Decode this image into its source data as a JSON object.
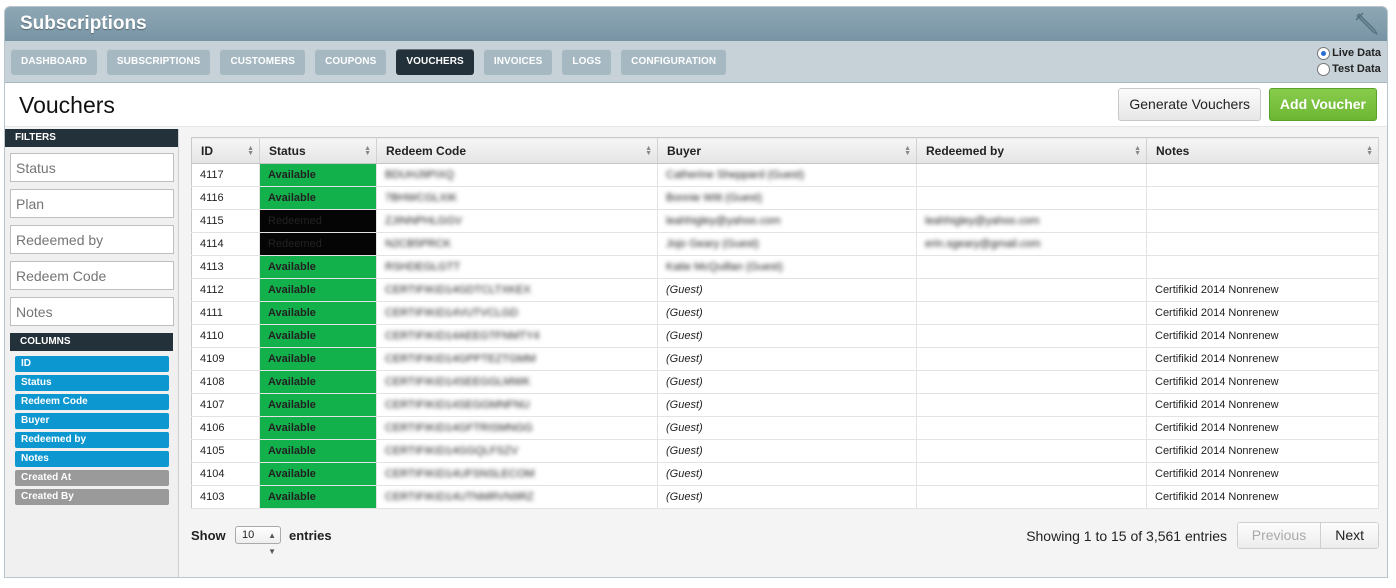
{
  "app": {
    "title": "Subscriptions",
    "icon": "pen-icon"
  },
  "nav": {
    "tabs": [
      "DASHBOARD",
      "SUBSCRIPTIONS",
      "CUSTOMERS",
      "COUPONS",
      "VOUCHERS",
      "INVOICES",
      "LOGS",
      "CONFIGURATION"
    ],
    "active": "VOUCHERS",
    "live_data_label": "Live Data",
    "test_data_label": "Test Data",
    "selected_data": "Live Data"
  },
  "page": {
    "title": "Vouchers",
    "generate_label": "Generate Vouchers",
    "add_label": "Add Voucher"
  },
  "sidebar": {
    "filters_heading": "FILTERS",
    "filters": {
      "status": "Status",
      "plan": "Plan",
      "redeemed_by": "Redeemed by",
      "redeem_code": "Redeem Code",
      "notes": "Notes"
    },
    "columns_heading": "COLUMNS",
    "columns": [
      {
        "label": "ID",
        "enabled": true
      },
      {
        "label": "Status",
        "enabled": true
      },
      {
        "label": "Redeem Code",
        "enabled": true
      },
      {
        "label": "Buyer",
        "enabled": true
      },
      {
        "label": "Redeemed by",
        "enabled": true
      },
      {
        "label": "Notes",
        "enabled": true
      },
      {
        "label": "Created At",
        "enabled": false
      },
      {
        "label": "Created By",
        "enabled": false
      }
    ]
  },
  "table": {
    "headers": [
      "ID",
      "Status",
      "Redeem Code",
      "Buyer",
      "Redeemed by",
      "Notes"
    ],
    "rows": [
      {
        "id": "4117",
        "status": "Available",
        "code": "BDUHJ9PIXQ",
        "buyer": "Catherine Sheppard (Guest)",
        "redeemed_by": "",
        "notes": ""
      },
      {
        "id": "4116",
        "status": "Available",
        "code": "7BHWCGLXIK",
        "buyer": "Bonnie Witt (Guest)",
        "redeemed_by": "",
        "notes": ""
      },
      {
        "id": "4115",
        "status": "Redeemed",
        "code": "ZJINNPHLGGV",
        "buyer": "leahhigley@yahoo.com",
        "redeemed_by": "leahhigley@yahoo.com",
        "notes": ""
      },
      {
        "id": "4114",
        "status": "Redeemed",
        "code": "N2CB5PRCK",
        "buyer": "Jojo Geary (Guest)",
        "redeemed_by": "erin.sgeary@gmail.com",
        "notes": ""
      },
      {
        "id": "4113",
        "status": "Available",
        "code": "RSHDEGLGTT",
        "buyer": "Katie McQuillan (Guest)",
        "redeemed_by": "",
        "notes": ""
      },
      {
        "id": "4112",
        "status": "Available",
        "code": "CERTIFIKID14GDTCLTXKEX",
        "buyer": "(Guest)",
        "redeemed_by": "",
        "notes": "Certifikid 2014 Nonrenew"
      },
      {
        "id": "4111",
        "status": "Available",
        "code": "CERTIFIKID14VUTVCLGD",
        "buyer": "(Guest)",
        "redeemed_by": "",
        "notes": "Certifikid 2014 Nonrenew"
      },
      {
        "id": "4110",
        "status": "Available",
        "code": "CERTIFIKID14AEEGTFNMTY4",
        "buyer": "(Guest)",
        "redeemed_by": "",
        "notes": "Certifikid 2014 Nonrenew"
      },
      {
        "id": "4109",
        "status": "Available",
        "code": "CERTIFIKID14GPPTEZTGMM",
        "buyer": "(Guest)",
        "redeemed_by": "",
        "notes": "Certifikid 2014 Nonrenew"
      },
      {
        "id": "4108",
        "status": "Available",
        "code": "CERTIFIKID14SEEGGLMWK",
        "buyer": "(Guest)",
        "redeemed_by": "",
        "notes": "Certifikid 2014 Nonrenew"
      },
      {
        "id": "4107",
        "status": "Available",
        "code": "CERTIFIKID14SEGGMNFNU",
        "buyer": "(Guest)",
        "redeemed_by": "",
        "notes": "Certifikid 2014 Nonrenew"
      },
      {
        "id": "4106",
        "status": "Available",
        "code": "CERTIFIKID14GFTRISMNGG",
        "buyer": "(Guest)",
        "redeemed_by": "",
        "notes": "Certifikid 2014 Nonrenew"
      },
      {
        "id": "4105",
        "status": "Available",
        "code": "CERTIFIKID14GGQLFSZV",
        "buyer": "(Guest)",
        "redeemed_by": "",
        "notes": "Certifikid 2014 Nonrenew"
      },
      {
        "id": "4104",
        "status": "Available",
        "code": "CERTIFIKID14UFSNSLECOM",
        "buyer": "(Guest)",
        "redeemed_by": "",
        "notes": "Certifikid 2014 Nonrenew"
      },
      {
        "id": "4103",
        "status": "Available",
        "code": "CERTIFIKID14UTNMRVN9RZ",
        "buyer": "(Guest)",
        "redeemed_by": "",
        "notes": "Certifikid 2014 Nonrenew"
      }
    ],
    "blurred_columns": [
      "code",
      "buyer_named",
      "redeemed_by"
    ]
  },
  "footer": {
    "show_label": "Show",
    "page_size": "10",
    "entries_label": "entries",
    "showing_text": "Showing 1 to 15 of 3,561 entries",
    "previous_label": "Previous",
    "next_label": "Next"
  },
  "colors": {
    "available": "#12b14b",
    "redeemed": "#050505",
    "accent": "#0d97d0",
    "add_button": "#6db634",
    "id_text": "#c41212"
  }
}
